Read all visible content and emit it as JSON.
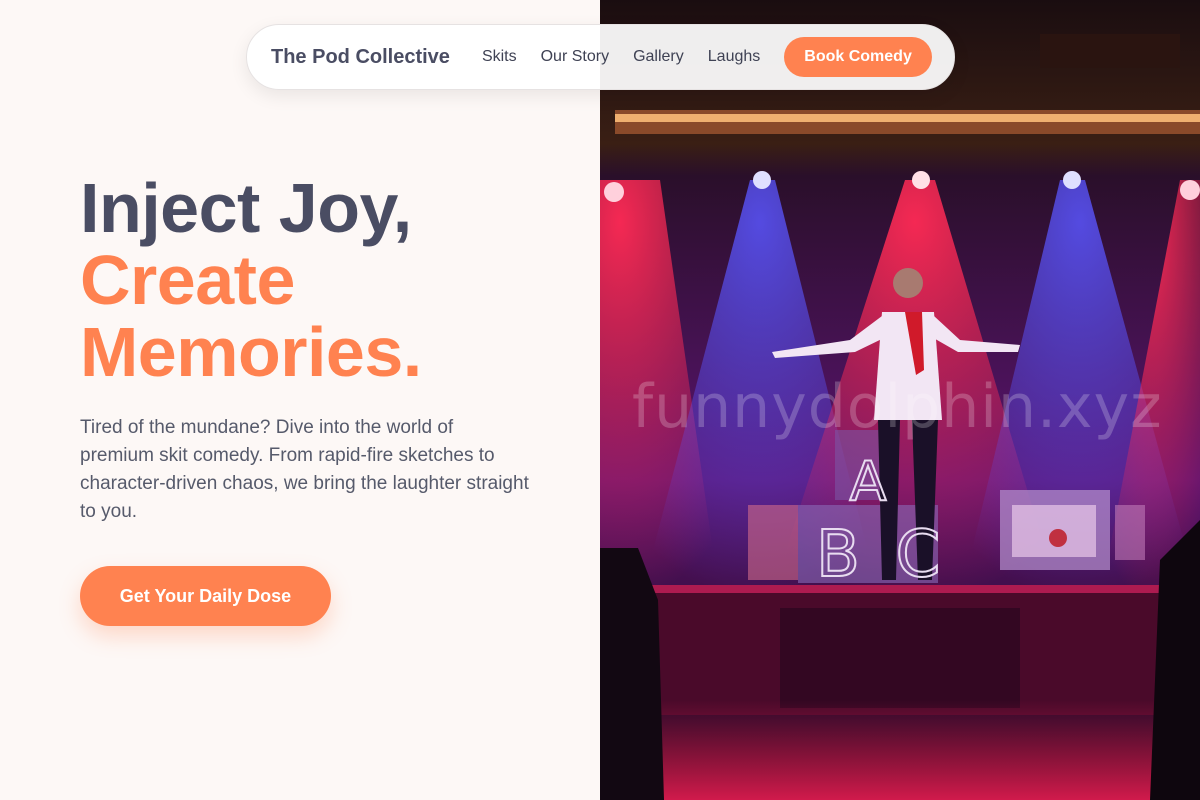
{
  "nav": {
    "brand": "The Pod Collective",
    "links": [
      "Skits",
      "Our Story",
      "Gallery",
      "Laughs"
    ],
    "cta": "Book Comedy"
  },
  "hero": {
    "title_line1": "Inject Joy,",
    "title_line2": "Create",
    "title_line3": "Memories.",
    "description": "Tired of the mundane? Dive into the world of premium skit comedy. From rapid-fire sketches to character-driven chaos, we bring the laughter straight to you.",
    "cta": "Get Your Daily Dose"
  },
  "image": {
    "watermark": "funnydolphin.xyz",
    "chalkboard_letters": [
      "A",
      "B",
      "C"
    ]
  },
  "colors": {
    "accent": "#ff8250",
    "heading": "#4a4d63",
    "body_text": "#565a6b",
    "background": "#fdf8f6"
  }
}
